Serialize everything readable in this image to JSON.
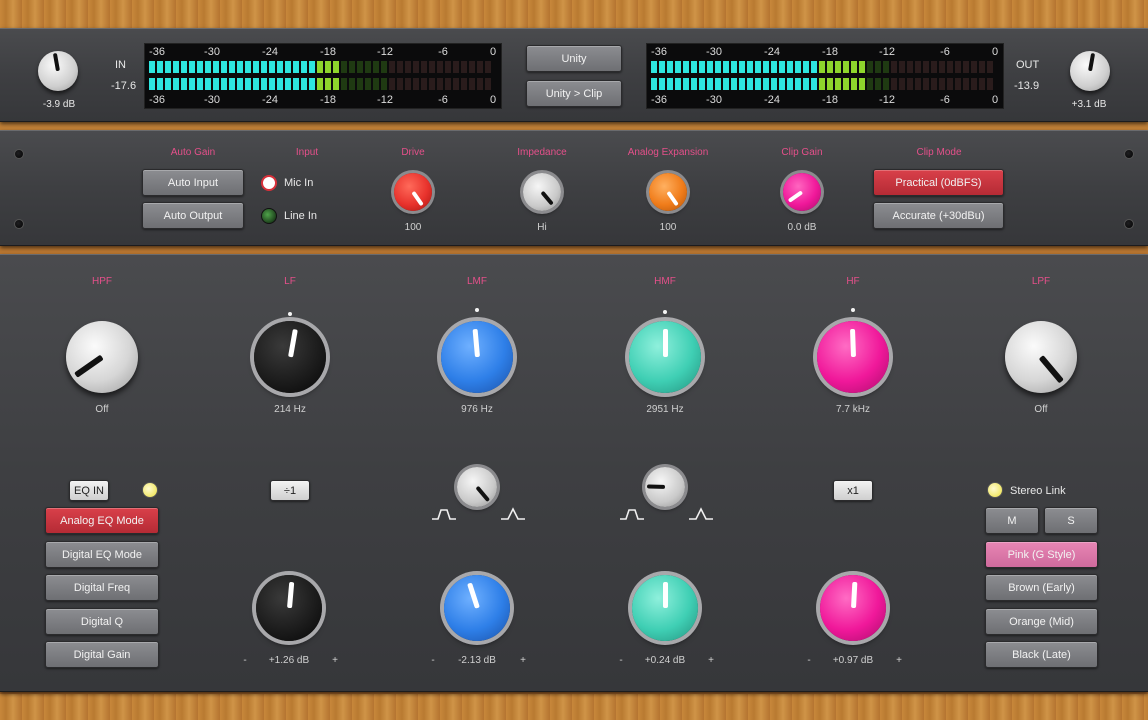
{
  "header": {
    "in_label": "IN",
    "in_level": "-17.6",
    "in_knob_value": "-3.9 dB",
    "out_label": "OUT",
    "out_level": "-13.9",
    "out_knob_value": "+3.1 dB",
    "meter_scale": [
      "-36",
      "-30",
      "-24",
      "-18",
      "-12",
      "-6",
      "0"
    ],
    "unity_button": "Unity",
    "unity_clip_button": "Unity > Clip"
  },
  "front": {
    "auto_gain_label": "Auto Gain",
    "auto_input_button": "Auto Input",
    "auto_output_button": "Auto Output",
    "input_label": "Input",
    "mic_in_label": "Mic In",
    "line_in_label": "Line In",
    "drive_label": "Drive",
    "drive_value": "100",
    "impedance_label": "Impedance",
    "impedance_value": "Hi",
    "analog_expansion_label": "Analog Expansion",
    "analog_expansion_value": "100",
    "clip_gain_label": "Clip Gain",
    "clip_gain_value": "0.0 dB",
    "clip_mode_label": "Clip Mode",
    "practical_button": "Practical (0dBFS)",
    "accurate_button": "Accurate (+30dBu)"
  },
  "eq": {
    "hpf_label": "HPF",
    "hpf_value": "Off",
    "lf_label": "LF",
    "lf_value": "214 Hz",
    "lmf_label": "LMF",
    "lmf_value": "976 Hz",
    "hmf_label": "HMF",
    "hmf_value": "2951 Hz",
    "hf_label": "HF",
    "hf_value": "7.7 kHz",
    "lpf_label": "LPF",
    "lpf_value": "Off",
    "eq_in_button": "EQ IN",
    "lf_div_button": "÷1",
    "hf_mul_button": "x1",
    "stereo_link_label": "Stereo Link",
    "m_button": "M",
    "s_button": "S",
    "mode_buttons": [
      "Analog EQ Mode",
      "Digital EQ Mode",
      "Digital Freq",
      "Digital Q",
      "Digital Gain"
    ],
    "style_buttons": [
      "Pink (G Style)",
      "Brown (Early)",
      "Orange (Mid)",
      "Black (Late)"
    ],
    "lf_gain_value": "+1.26 dB",
    "lmf_gain_value": "-2.13 dB",
    "hmf_gain_value": "+0.24 dB",
    "hf_gain_value": "+0.97 dB",
    "minus": "-",
    "plus": "+"
  },
  "colors": {
    "accent_pink": "#e4508a",
    "meter_cyan": "#2ee6e0",
    "meter_green": "#8ed62c",
    "knob_red": "#e8322c",
    "knob_orange": "#f07c1a",
    "knob_magenta": "#f0189a",
    "knob_blue": "#2e7fe8",
    "knob_teal": "#3fcfb4",
    "knob_black": "#1a1a1a"
  },
  "meters": {
    "in_level_fraction": 0.55,
    "out_level_fraction": 0.63
  }
}
